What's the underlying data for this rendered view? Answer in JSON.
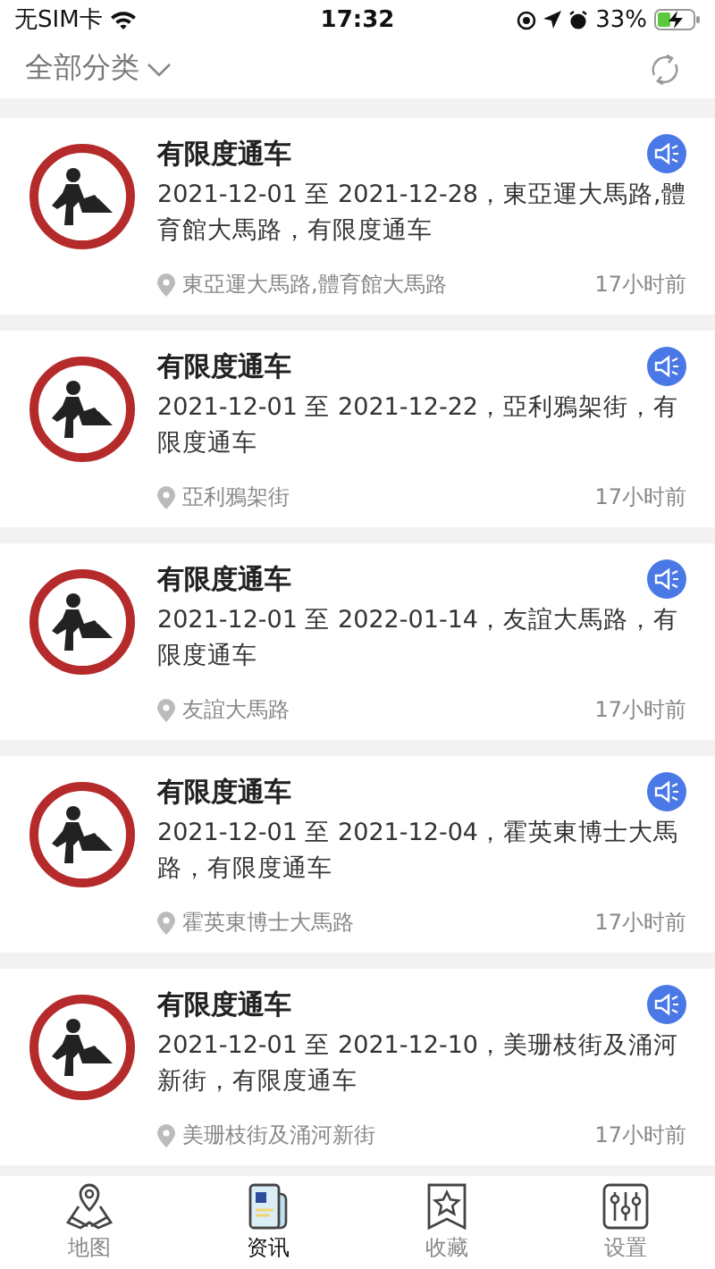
{
  "status_bar": {
    "carrier": "无SIM卡",
    "time": "17:32",
    "battery": "33%"
  },
  "header": {
    "filter": "全部分类"
  },
  "items": [
    {
      "title": "有限度通车",
      "description": "2021-12-01 至 2021-12-28，東亞運大馬路,體育館大馬路，有限度通车",
      "location": "東亞運大馬路,體育館大馬路",
      "time": "17小时前"
    },
    {
      "title": "有限度通车",
      "description": "2021-12-01 至 2021-12-22，亞利鴉架街，有限度通车",
      "location": "亞利鴉架街",
      "time": "17小时前"
    },
    {
      "title": "有限度通车",
      "description": "2021-12-01 至 2022-01-14，友誼大馬路，有限度通车",
      "location": "友誼大馬路",
      "time": "17小时前"
    },
    {
      "title": "有限度通车",
      "description": "2021-12-01 至 2021-12-04，霍英東博士大馬路，有限度通车",
      "location": "霍英東博士大馬路",
      "time": "17小时前"
    },
    {
      "title": "有限度通车",
      "description": "2021-12-01 至 2021-12-10，美珊枝街及涌河新街，有限度通车",
      "location": "美珊枝街及涌河新街",
      "time": "17小时前"
    }
  ],
  "tabs": [
    {
      "kind": "map",
      "label": "地图",
      "selected": false
    },
    {
      "kind": "news",
      "label": "资讯",
      "selected": true
    },
    {
      "kind": "favorites",
      "label": "收藏",
      "selected": false
    },
    {
      "kind": "settings",
      "label": "设置",
      "selected": false
    }
  ]
}
